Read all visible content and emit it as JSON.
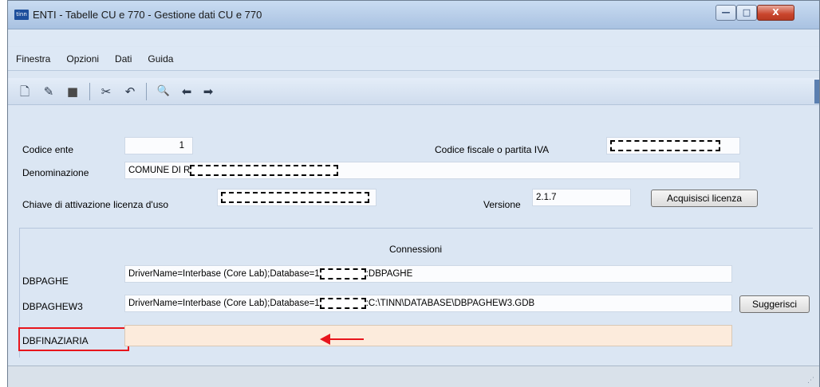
{
  "window": {
    "app_logo": "tinn",
    "title": "ENTI - Tabelle CU e 770 - Gestione dati CU e 770",
    "controls": {
      "minimize": "—",
      "maximize": "□",
      "close": "X"
    }
  },
  "menu": [
    "Finestra",
    "Opzioni",
    "Dati",
    "Guida"
  ],
  "toolbar": {
    "icons": [
      "new-document-icon",
      "edit-icon",
      "stop-icon",
      "cut-icon",
      "undo-icon",
      "search-icon",
      "back-arrow-icon",
      "forward-arrow-icon"
    ],
    "glyphs": {
      "new": "🗋",
      "edit": "✎",
      "stop": "■",
      "cut": "✂",
      "undo": "↶",
      "search": "🔍",
      "back": "⬅",
      "forward": "➡"
    }
  },
  "form": {
    "codice_ente": {
      "label": "Codice ente",
      "value": "1"
    },
    "codice_fiscale": {
      "label": "Codice fiscale o partita IVA",
      "value": ""
    },
    "denominazione": {
      "label": "Denominazione",
      "value": "COMUNE DI R"
    },
    "chiave": {
      "label": "Chiave di attivazione licenza d'uso",
      "value": ""
    },
    "versione": {
      "label": "Versione",
      "value": "2.1.7"
    },
    "acquisisci_button": "Acquisisci licenza"
  },
  "connections": {
    "title": "Connessioni",
    "rows": [
      {
        "label": "DBPAGHE",
        "prefix": "DriverName=Interbase (Core Lab);Database=1",
        "suffix": ":DBPAGHE"
      },
      {
        "label": "DBPAGHEW3",
        "prefix": "DriverName=Interbase (Core Lab);Database=1",
        "suffix": ":C:\\TINN\\DATABASE\\DBPAGHEW3.GDB"
      },
      {
        "label": "DBFINAZIARIA",
        "prefix": "",
        "suffix": ""
      }
    ],
    "suggerisci_button": "Suggerisci"
  },
  "colors": {
    "highlight": "#e8151c",
    "field_highlight": "#fcebdc"
  }
}
